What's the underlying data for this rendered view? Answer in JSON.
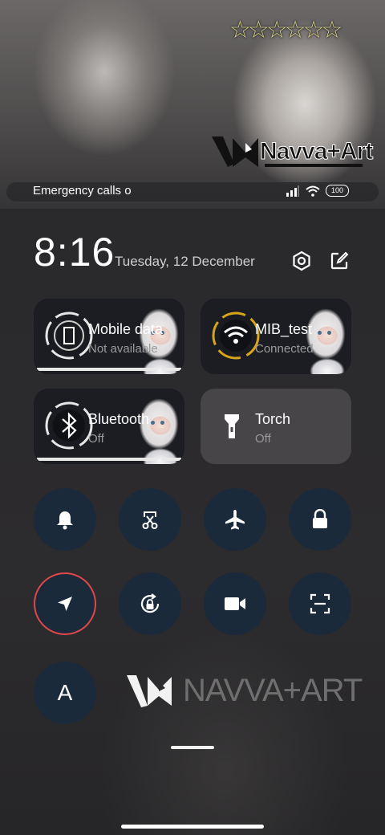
{
  "wallpaper": {
    "stars": "☆☆☆☆☆☆",
    "brand_top": "Navva+Art",
    "brand_bottom": "NAVVA+ART"
  },
  "status": {
    "emergency_text": "Emergency calls o",
    "battery": "100"
  },
  "header": {
    "time": "8:16",
    "date": "Tuesday, 12 December"
  },
  "tiles": [
    {
      "title": "Mobile data",
      "subtitle": "Not available"
    },
    {
      "title": "MIB_test",
      "subtitle": "Connected"
    },
    {
      "title": "Bluetooth",
      "subtitle": "Off"
    },
    {
      "title": "Torch",
      "subtitle": "Off"
    }
  ],
  "toggles": {
    "font_label": "A"
  },
  "colors": {
    "tile_active_ring": "#e0474b",
    "toggle_bg": "#1b2a3b",
    "wifi_accent": "#d8a51a"
  }
}
